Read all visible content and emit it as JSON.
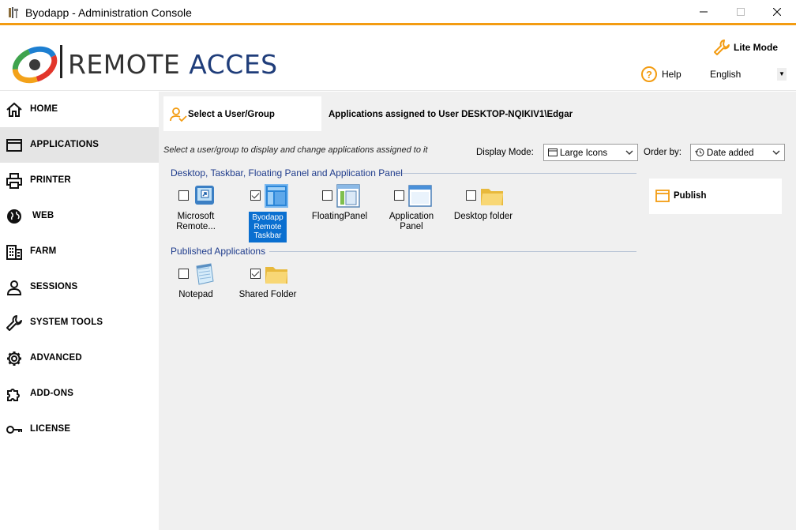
{
  "window": {
    "title": "Byodapp - Administration Console"
  },
  "header": {
    "logo_text_1": "REMOTE",
    "logo_text_2": "ACCES",
    "lite_mode_label": "Lite Mode",
    "help_label": "Help",
    "language": "English"
  },
  "sidebar": {
    "items": [
      {
        "label": "HOME",
        "icon": "home-icon"
      },
      {
        "label": "APPLICATIONS",
        "icon": "window-icon"
      },
      {
        "label": "PRINTER",
        "icon": "printer-icon"
      },
      {
        "label": "WEB",
        "icon": "globe-icon"
      },
      {
        "label": "FARM",
        "icon": "building-icon"
      },
      {
        "label": "SESSIONS",
        "icon": "user-icon"
      },
      {
        "label": "SYSTEM TOOLS",
        "icon": "wrench-icon"
      },
      {
        "label": "ADVANCED",
        "icon": "gear-icon"
      },
      {
        "label": "ADD-ONS",
        "icon": "puzzle-icon"
      },
      {
        "label": "LICENSE",
        "icon": "key-icon"
      }
    ],
    "active": "APPLICATIONS"
  },
  "main": {
    "select_user_group": "Select a User/Group",
    "assigned_label": "Applications assigned to User DESKTOP-NQIKIV1\\Edgar",
    "hint": "Select a user/group to display and change applications assigned to it",
    "display_mode_label": "Display Mode:",
    "display_mode_value": "Large Icons",
    "order_by_label": "Order by:",
    "order_by_value": "Date added",
    "groups": [
      {
        "title": "Desktop, Taskbar, Floating Panel and Application Panel",
        "apps": [
          {
            "label": "Microsoft Remote...",
            "checked": false,
            "selected": false,
            "icon": "remote-desktop-icon"
          },
          {
            "label": "Byodapp Remote Taskbar",
            "checked": true,
            "selected": true,
            "icon": "taskbar-icon"
          },
          {
            "label": "FloatingPanel",
            "checked": false,
            "selected": false,
            "icon": "floating-panel-icon"
          },
          {
            "label": "Application Panel",
            "checked": false,
            "selected": false,
            "icon": "application-panel-icon"
          },
          {
            "label": "Desktop folder",
            "checked": false,
            "selected": false,
            "icon": "folder-icon"
          }
        ]
      },
      {
        "title": "Published Applications",
        "apps": [
          {
            "label": "Notepad",
            "checked": false,
            "selected": false,
            "icon": "notepad-icon"
          },
          {
            "label": "Shared Folder",
            "checked": true,
            "selected": false,
            "icon": "folder-icon"
          }
        ]
      }
    ],
    "publish_label": "Publish"
  },
  "colors": {
    "accent": "#f39c12",
    "selection": "#0a6fd0",
    "group_title": "#1f3c8c"
  }
}
